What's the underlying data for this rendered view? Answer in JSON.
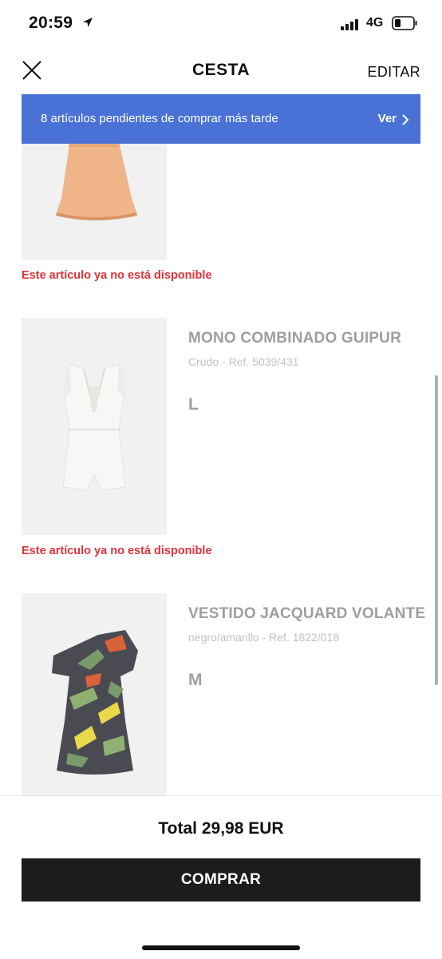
{
  "status": {
    "time": "20:59",
    "network": "4G"
  },
  "header": {
    "title": "CESTA",
    "edit_label": "EDITAR"
  },
  "banner": {
    "text": "8 artículos pendientes de comprar más tarde",
    "link": "Ver"
  },
  "items": [
    {
      "name": "",
      "ref": "",
      "size": "",
      "unavailable": "Este artículo ya no está disponible",
      "image": "peach-dress"
    },
    {
      "name": "MONO COMBINADO GUIPUR",
      "ref": "Crudo - Ref. 5039/431",
      "size": "L",
      "unavailable": "Este artículo ya no está disponible",
      "image": "white-jumpsuit"
    },
    {
      "name": "VESTIDO JACQUARD VOLANTE",
      "ref": "negro/amarillo - Ref. 1822/018",
      "size": "M",
      "unavailable": "",
      "image": "tropical-dress"
    }
  ],
  "footer": {
    "total": "Total 29,98 EUR",
    "buy_label": "COMPRAR"
  },
  "colors": {
    "banner": "#4a72d6",
    "unavailable": "#e0323a",
    "buy_button": "#1c1c1c"
  }
}
